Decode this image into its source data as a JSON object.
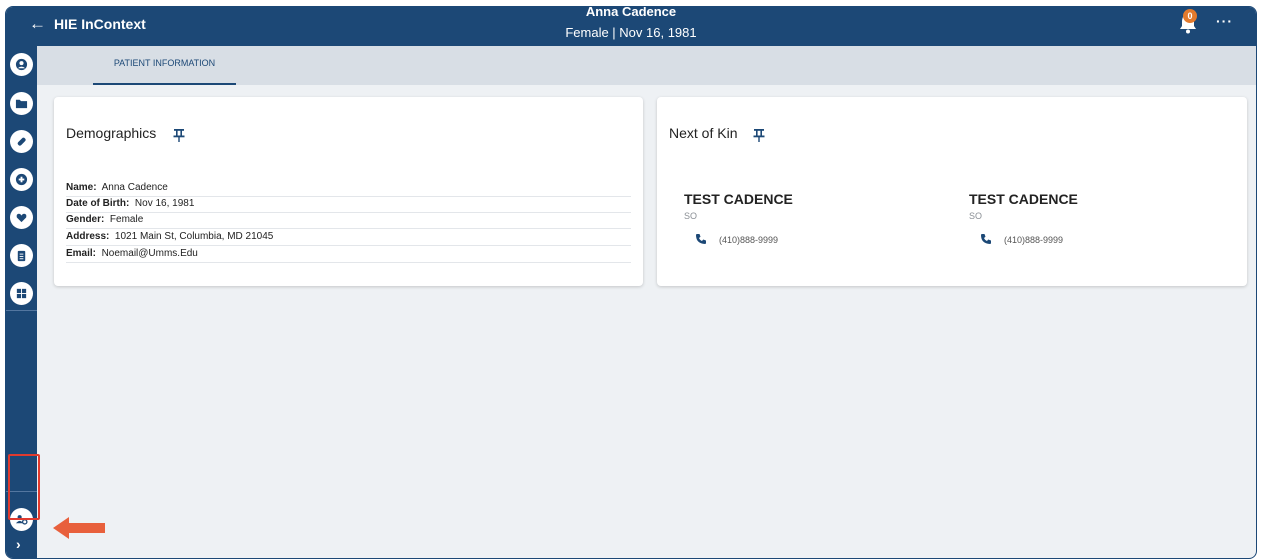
{
  "header": {
    "back_icon": "arrow-left-icon",
    "app_title": "HIE InContext",
    "patient_name": "Anna Cadence",
    "patient_subtitle": "Female | Nov 16, 1981",
    "notification_count": "0",
    "more_label": "···"
  },
  "sidebar": {
    "items": [
      {
        "icon": "user-icon"
      },
      {
        "icon": "folder-icon"
      },
      {
        "icon": "pill-icon"
      },
      {
        "icon": "lab-icon"
      },
      {
        "icon": "care-icon"
      },
      {
        "icon": "clipboard-icon"
      },
      {
        "icon": "dashboard-icon"
      },
      {
        "icon": "user-settings-icon"
      }
    ],
    "expand_label": "›"
  },
  "tabs": [
    {
      "label": "PATIENT INFORMATION",
      "active": true
    }
  ],
  "demographics": {
    "title": "Demographics",
    "fields": [
      {
        "label": "Name:",
        "value": "Anna Cadence"
      },
      {
        "label": "Date of Birth:",
        "value": "Nov 16, 1981"
      },
      {
        "label": "Gender:",
        "value": "Female"
      },
      {
        "label": "Address:",
        "value": "1021 Main St, Columbia, MD 21045"
      },
      {
        "label": "Email:",
        "value": "Noemail@Umms.Edu"
      }
    ]
  },
  "next_of_kin": {
    "title": "Next of Kin",
    "contacts": [
      {
        "name": "TEST CADENCE",
        "relation": "SO",
        "phone": "(410)888-9999"
      },
      {
        "name": "TEST CADENCE",
        "relation": "SO",
        "phone": "(410)888-9999"
      }
    ]
  },
  "colors": {
    "brand": "#1c4876",
    "background": "#eef1f4",
    "tab_bar": "#d8dee5",
    "badge": "#e37a2c",
    "annotation": "#e8603c",
    "highlight_border": "#e03a2e"
  }
}
